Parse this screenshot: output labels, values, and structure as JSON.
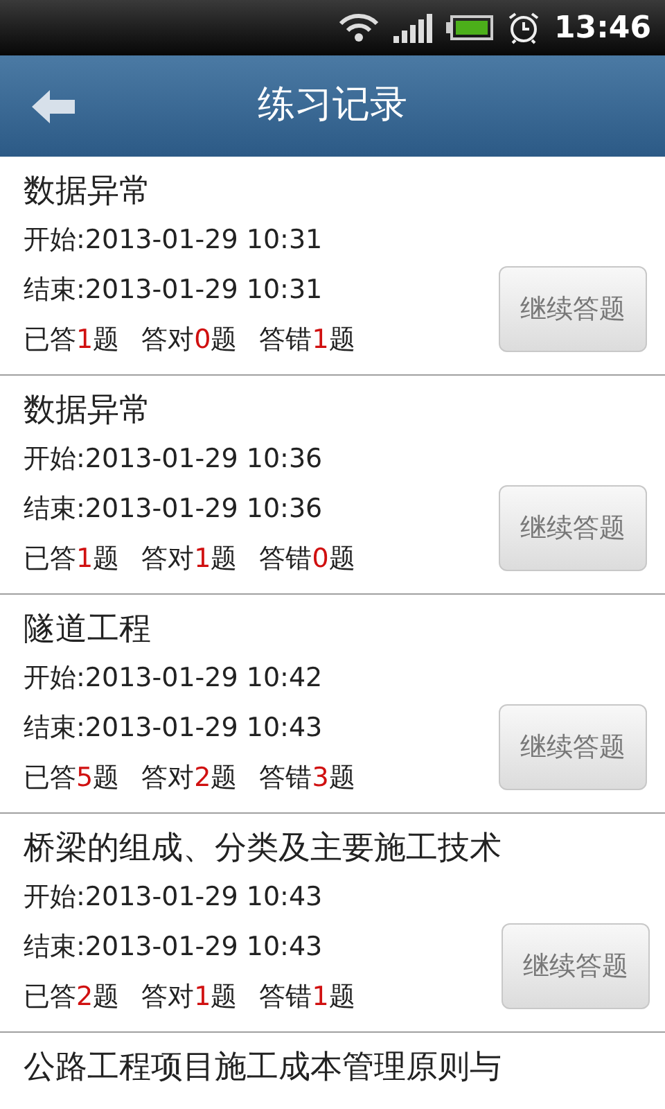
{
  "status_bar": {
    "time": "13:46"
  },
  "header": {
    "title": "练习记录"
  },
  "records": [
    {
      "title": "数据异常",
      "start": "开始:2013-01-29 10:31",
      "end": "结束:2013-01-29 10:31",
      "stats": [
        {
          "label": "已答",
          "count": "1",
          "unit": "题"
        },
        {
          "label": "答对",
          "count": "0",
          "unit": "题"
        },
        {
          "label": "答错",
          "count": "1",
          "unit": "题"
        }
      ],
      "button": "继续答题"
    },
    {
      "title": "数据异常",
      "start": "开始:2013-01-29 10:36",
      "end": "结束:2013-01-29 10:36",
      "stats": [
        {
          "label": "已答",
          "count": "1",
          "unit": "题"
        },
        {
          "label": "答对",
          "count": "1",
          "unit": "题"
        },
        {
          "label": "答错",
          "count": "0",
          "unit": "题"
        }
      ],
      "button": "继续答题"
    },
    {
      "title": "隧道工程",
      "start": "开始:2013-01-29 10:42",
      "end": "结束:2013-01-29 10:43",
      "stats": [
        {
          "label": "已答",
          "count": "5",
          "unit": "题"
        },
        {
          "label": "答对",
          "count": "2",
          "unit": "题"
        },
        {
          "label": "答错",
          "count": "3",
          "unit": "题"
        }
      ],
      "button": "继续答题"
    },
    {
      "title": "桥梁的组成、分类及主要施工技术",
      "start": "开始:2013-01-29 10:43",
      "end": "结束:2013-01-29 10:43",
      "stats": [
        {
          "label": "已答",
          "count": "2",
          "unit": "题"
        },
        {
          "label": "答对",
          "count": "1",
          "unit": "题"
        },
        {
          "label": "答错",
          "count": "1",
          "unit": "题"
        }
      ],
      "button": "继续答题"
    },
    {
      "title": "公路工程项目施工成本管理原则与"
    }
  ]
}
